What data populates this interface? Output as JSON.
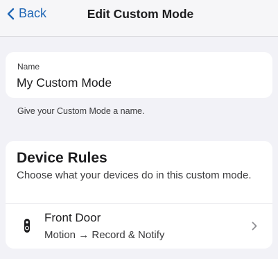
{
  "nav": {
    "back_label": "Back",
    "title": "Edit Custom Mode"
  },
  "name_field": {
    "label": "Name",
    "value": "My Custom Mode",
    "hint": "Give your Custom Mode a name."
  },
  "device_rules": {
    "title": "Device Rules",
    "description": "Choose what your devices do in this custom mode.",
    "devices": [
      {
        "name": "Front Door",
        "rule": "Motion → Record & Notify",
        "icon": "doorbell-icon"
      }
    ]
  },
  "colors": {
    "accent": "#1f66b5",
    "background": "#f2f2f7",
    "card": "#ffffff"
  }
}
